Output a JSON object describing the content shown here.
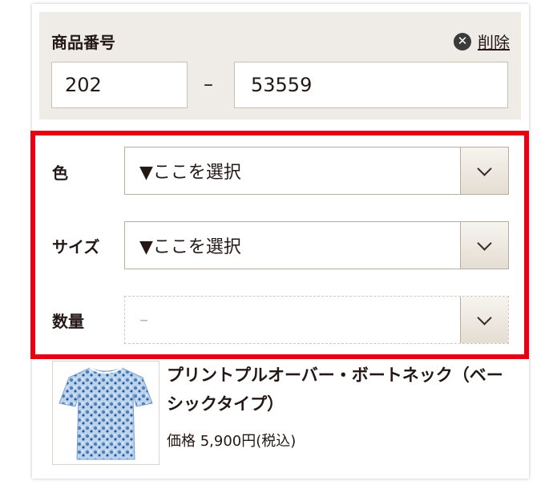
{
  "product_number": {
    "label": "商品番号",
    "delete_label": "削除",
    "part1": "202",
    "separator": "–",
    "part2": "53559"
  },
  "options": [
    {
      "label": "色",
      "value": "▼ここを選択",
      "enabled": true
    },
    {
      "label": "サイズ",
      "value": "▼ここを選択",
      "enabled": true
    },
    {
      "label": "数量",
      "value": "–",
      "enabled": false
    }
  ],
  "product": {
    "name": "プリントプルオーバー・ボートネック（ベーシックタイプ）",
    "price": "価格 5,900円(税込)",
    "image_icon": "tshirt-image"
  },
  "colors": {
    "highlight": "#e60012",
    "panel_bg": "#efebe6",
    "text": "#231815"
  }
}
